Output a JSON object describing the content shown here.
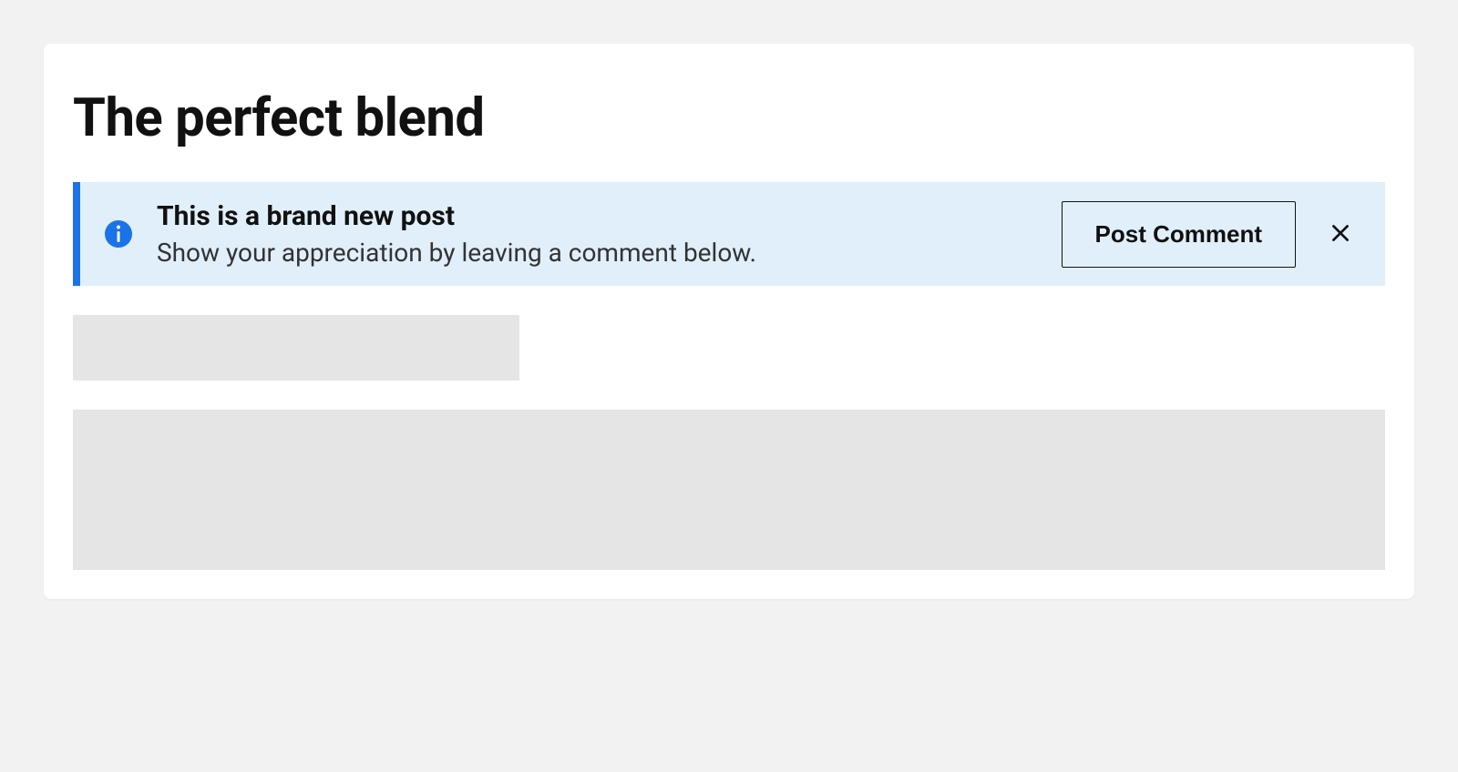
{
  "page": {
    "title": "The perfect blend"
  },
  "alert": {
    "title": "This is a brand new post",
    "description": "Show your appreciation by leaving a comment below.",
    "action_label": "Post Comment"
  }
}
